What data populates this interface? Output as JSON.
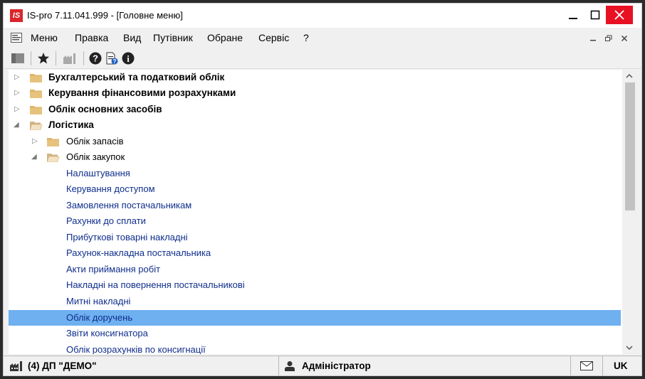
{
  "window": {
    "app_logo": "IS",
    "title": "IS-pro 7.11.041.999 - [Головне меню]"
  },
  "menubar": {
    "items": [
      "Меню",
      "Правка",
      "Вид",
      "Путівник",
      "Обране",
      "Сервіс",
      "?"
    ]
  },
  "tree": {
    "items": [
      {
        "label": "Бухгалтерський та податковий облік",
        "level": 0,
        "state": "collapsed",
        "style": "bold"
      },
      {
        "label": "Керування фінансовими розрахунками",
        "level": 0,
        "state": "collapsed",
        "style": "bold"
      },
      {
        "label": "Облік основних засобів",
        "level": 0,
        "state": "collapsed",
        "style": "bold"
      },
      {
        "label": "Логістика",
        "level": 0,
        "state": "expanded",
        "style": "bold"
      },
      {
        "label": "Облік запасів",
        "level": 1,
        "state": "collapsed",
        "style": "normal"
      },
      {
        "label": "Облік закупок",
        "level": 1,
        "state": "expanded",
        "style": "normal"
      },
      {
        "label": "Налаштування",
        "level": 2,
        "style": "link"
      },
      {
        "label": "Керування доступом",
        "level": 2,
        "style": "link"
      },
      {
        "label": "Замовлення постачальникам",
        "level": 2,
        "style": "link"
      },
      {
        "label": "Рахунки до сплати",
        "level": 2,
        "style": "link"
      },
      {
        "label": "Прибуткові товарні накладні",
        "level": 2,
        "style": "link"
      },
      {
        "label": "Рахунок-накладна постачальника",
        "level": 2,
        "style": "link"
      },
      {
        "label": "Акти приймання робіт",
        "level": 2,
        "style": "link"
      },
      {
        "label": "Накладні на повернення постачальникові",
        "level": 2,
        "style": "link"
      },
      {
        "label": "Митні накладні",
        "level": 2,
        "style": "link"
      },
      {
        "label": "Облік доручень",
        "level": 2,
        "style": "link",
        "selected": true
      },
      {
        "label": "Звіти консигнатора",
        "level": 2,
        "style": "link"
      },
      {
        "label": "Облік розрахунків по консигнації",
        "level": 2,
        "style": "link"
      }
    ]
  },
  "statusbar": {
    "company": "(4) ДП \"ДЕМО\"",
    "user": "Адміністратор",
    "language": "UK"
  },
  "colors": {
    "selection": "#6fb0f0",
    "link": "#0f2e8c",
    "close_button": "#e81123",
    "logo": "#d9262a",
    "folder": "#d9b46a"
  }
}
